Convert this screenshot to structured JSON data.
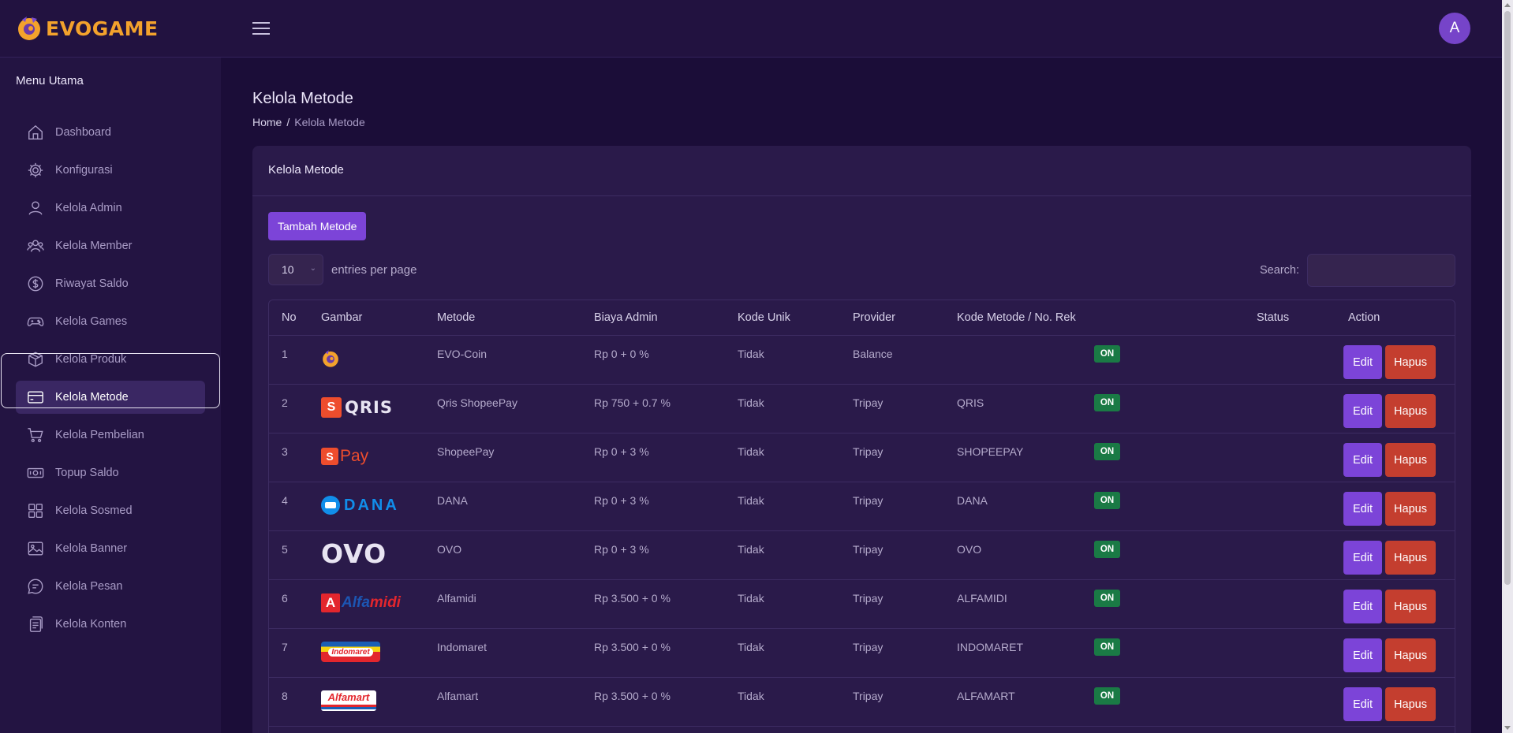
{
  "brand": {
    "name": "EVOGAME",
    "icon": "evogame-logo-icon"
  },
  "header": {
    "menu_icon": "hamburger-icon",
    "avatar_letter": "A"
  },
  "sidebar": {
    "title": "Menu Utama",
    "items": [
      {
        "label": "Dashboard",
        "icon": "home-icon"
      },
      {
        "label": "Konfigurasi",
        "icon": "gear-icon"
      },
      {
        "label": "Kelola Admin",
        "icon": "user-icon"
      },
      {
        "label": "Kelola Member",
        "icon": "users-icon"
      },
      {
        "label": "Riwayat Saldo",
        "icon": "dollar-icon"
      },
      {
        "label": "Kelola Games",
        "icon": "gamepad-icon"
      },
      {
        "label": "Kelola Produk",
        "icon": "box-icon"
      },
      {
        "label": "Kelola Metode",
        "icon": "card-icon",
        "active": true
      },
      {
        "label": "Kelola Pembelian",
        "icon": "cart-icon"
      },
      {
        "label": "Topup Saldo",
        "icon": "money-icon"
      },
      {
        "label": "Kelola Sosmed",
        "icon": "grid-icon"
      },
      {
        "label": "Kelola Banner",
        "icon": "image-icon"
      },
      {
        "label": "Kelola Pesan",
        "icon": "chat-icon"
      },
      {
        "label": "Kelola Konten",
        "icon": "document-icon"
      }
    ]
  },
  "page": {
    "title": "Kelola Metode",
    "breadcrumb": {
      "home": "Home",
      "separator": "/",
      "current": "Kelola Metode"
    }
  },
  "card": {
    "title": "Kelola Metode",
    "add_button": "Tambah Metode",
    "entries_value": "10",
    "entries_label": "entries per page",
    "search_label": "Search:",
    "search_value": ""
  },
  "table": {
    "headers": [
      "No",
      "Gambar",
      "Metode",
      "Biaya Admin",
      "Kode Unik",
      "Provider",
      "Kode Metode / No. Rek",
      "Status",
      "Action"
    ],
    "rows": [
      {
        "no": "1",
        "logo": "evo-coin-logo",
        "metode": "EVO-Coin",
        "biaya": "Rp 0 + 0 %",
        "kode_unik": "Tidak",
        "provider": "Balance",
        "kode": "",
        "status": "ON"
      },
      {
        "no": "2",
        "logo": "qris-logo",
        "metode": "Qris ShopeePay",
        "biaya": "Rp 750 + 0.7 %",
        "kode_unik": "Tidak",
        "provider": "Tripay",
        "kode": "QRIS",
        "status": "ON"
      },
      {
        "no": "3",
        "logo": "shopeepay-logo",
        "metode": "ShopeePay",
        "biaya": "Rp 0 + 3 %",
        "kode_unik": "Tidak",
        "provider": "Tripay",
        "kode": "SHOPEEPAY",
        "status": "ON"
      },
      {
        "no": "4",
        "logo": "dana-logo",
        "metode": "DANA",
        "biaya": "Rp 0 + 3 %",
        "kode_unik": "Tidak",
        "provider": "Tripay",
        "kode": "DANA",
        "status": "ON"
      },
      {
        "no": "5",
        "logo": "ovo-logo",
        "metode": "OVO",
        "biaya": "Rp 0 + 3 %",
        "kode_unik": "Tidak",
        "provider": "Tripay",
        "kode": "OVO",
        "status": "ON"
      },
      {
        "no": "6",
        "logo": "alfamidi-logo",
        "metode": "Alfamidi",
        "biaya": "Rp 3.500 + 0 %",
        "kode_unik": "Tidak",
        "provider": "Tripay",
        "kode": "ALFAMIDI",
        "status": "ON"
      },
      {
        "no": "7",
        "logo": "indomaret-logo",
        "metode": "Indomaret",
        "biaya": "Rp 3.500 + 0 %",
        "kode_unik": "Tidak",
        "provider": "Tripay",
        "kode": "INDOMARET",
        "status": "ON"
      },
      {
        "no": "8",
        "logo": "alfamart-logo",
        "metode": "Alfamart",
        "biaya": "Rp 3.500 + 0 %",
        "kode_unik": "Tidak",
        "provider": "Tripay",
        "kode": "ALFAMART",
        "status": "ON"
      }
    ],
    "edit_label": "Edit",
    "delete_label": "Hapus"
  },
  "logo_text": {
    "shopee_mark": "S",
    "qris": "QRIS",
    "pay": "Pay",
    "dana": "DANA",
    "ovo": "OVO",
    "alfamidi_mark": "A",
    "alfamidi": "Alfamidi",
    "indomaret": "Indomaret",
    "alfamart": "Alfamart"
  },
  "colors": {
    "accent": "#7c44d8",
    "danger": "#c43e2f",
    "success": "#1a7a45",
    "brand": "#f3a22c",
    "background": "#1b0d38"
  }
}
